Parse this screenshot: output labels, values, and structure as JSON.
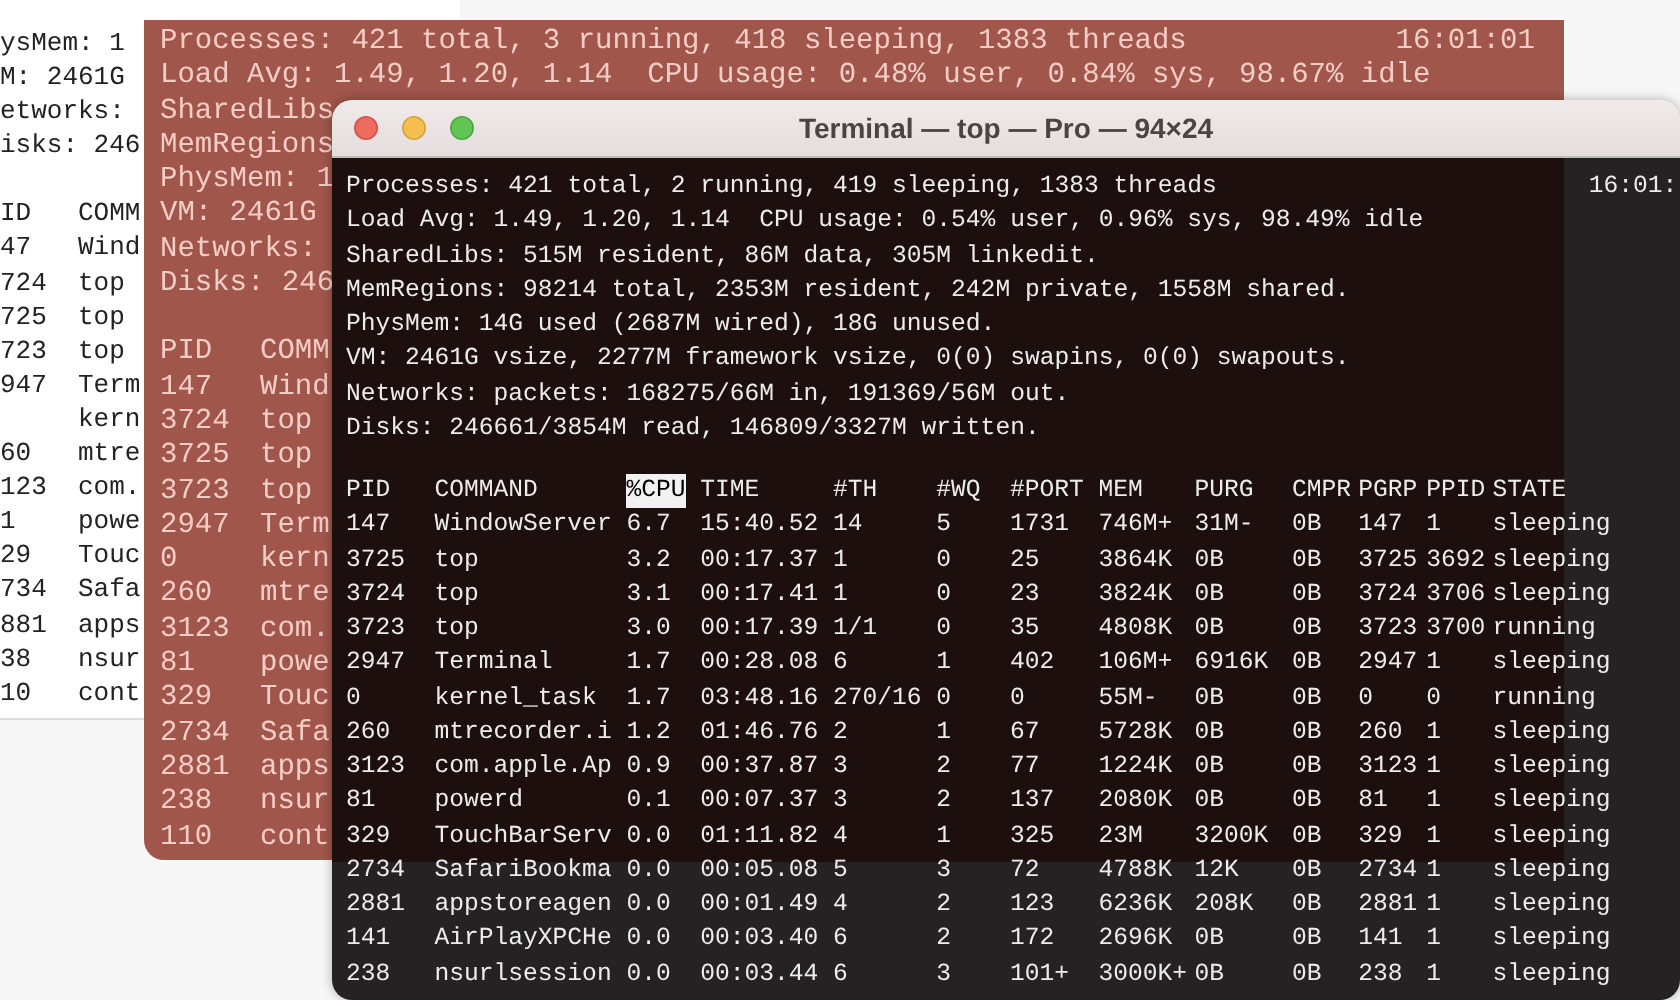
{
  "back_window": {
    "summary": [
      "ysMem: 1",
      "M: 2461G",
      "etworks:",
      "isks: 246"
    ],
    "rows": [
      {
        "pid": "ID",
        "command": "COMM"
      },
      {
        "pid": "47",
        "command": "Wind"
      },
      {
        "pid": "724",
        "command": "top"
      },
      {
        "pid": "725",
        "command": "top"
      },
      {
        "pid": "723",
        "command": "top"
      },
      {
        "pid": "947",
        "command": "Term"
      },
      {
        "command": "kern"
      },
      {
        "pid": "60",
        "command": "mtre"
      },
      {
        "pid": "123",
        "command": "com."
      },
      {
        "pid": "1",
        "command": "powe"
      },
      {
        "pid": "29",
        "command": "Touc"
      },
      {
        "pid": "734",
        "command": "Safa"
      },
      {
        "pid": "881",
        "command": "apps"
      },
      {
        "pid": "38",
        "command": "nsur"
      },
      {
        "pid": "10",
        "command": "cont"
      }
    ]
  },
  "middle_window": {
    "time": "16:01:01",
    "summary": [
      "Processes: 421 total, 3 running, 418 sleeping, 1383 threads",
      "Load Avg: 1.49, 1.20, 1.14  CPU usage: 0.48% user, 0.84% sys, 98.67% idle",
      "SharedLibs",
      "MemRegions",
      "PhysMem: 1",
      "VM: 2461G",
      "Networks:",
      "Disks: 246"
    ],
    "rows": [
      {
        "pid": "PID",
        "command": "COMM"
      },
      {
        "pid": "147",
        "command": "Wind"
      },
      {
        "pid": "3724",
        "command": "top"
      },
      {
        "pid": "3725",
        "command": "top"
      },
      {
        "pid": "3723",
        "command": "top"
      },
      {
        "pid": "2947",
        "command": "Term"
      },
      {
        "pid": "0",
        "command": "kern"
      },
      {
        "pid": "260",
        "command": "mtre"
      },
      {
        "pid": "3123",
        "command": "com."
      },
      {
        "pid": "81",
        "command": "powe"
      },
      {
        "pid": "329",
        "command": "Touc"
      },
      {
        "pid": "2734",
        "command": "Safa"
      },
      {
        "pid": "2881",
        "command": "apps"
      },
      {
        "pid": "238",
        "command": "nsur"
      },
      {
        "pid": "110",
        "command": "cont"
      }
    ]
  },
  "terminal": {
    "title": "Terminal — top — Pro — 94×24",
    "time": "16:01:",
    "summary": [
      "Processes: 421 total, 2 running, 419 sleeping, 1383 threads",
      "Load Avg: 1.49, 1.20, 1.14  CPU usage: 0.54% user, 0.96% sys, 98.49% idle",
      "SharedLibs: 515M resident, 86M data, 305M linkedit.",
      "MemRegions: 98214 total, 2353M resident, 242M private, 1558M shared.",
      "PhysMem: 14G used (2687M wired), 18G unused.",
      "VM: 2461G vsize, 2277M framework vsize, 0(0) swapins, 0(0) swapouts.",
      "Networks: packets: 168275/66M in, 191369/56M out.",
      "Disks: 246661/3854M read, 146809/3327M written."
    ],
    "columns": [
      {
        "label": "PID",
        "sorted": false
      },
      {
        "label": "COMMAND",
        "sorted": false
      },
      {
        "label": "%CPU",
        "sorted": true
      },
      {
        "label": "TIME",
        "sorted": false
      },
      {
        "label": "#TH",
        "sorted": false
      },
      {
        "label": "#WQ",
        "sorted": false
      },
      {
        "label": "#PORT",
        "sorted": false
      },
      {
        "label": "MEM",
        "sorted": false
      },
      {
        "label": "PURG",
        "sorted": false
      },
      {
        "label": "CMPR",
        "sorted": false
      },
      {
        "label": "PGRP",
        "sorted": false
      },
      {
        "label": "PPID",
        "sorted": false
      },
      {
        "label": "STATE",
        "sorted": false
      }
    ],
    "rows": [
      [
        "147",
        "WindowServer",
        "6.7",
        "15:40.52",
        "14",
        "5",
        "1731",
        "746M+",
        "31M-",
        "0B",
        "147",
        "1",
        "sleeping"
      ],
      [
        "3725",
        "top",
        "3.2",
        "00:17.37",
        "1",
        "0",
        "25",
        "3864K",
        "0B",
        "0B",
        "3725",
        "3692",
        "sleeping"
      ],
      [
        "3724",
        "top",
        "3.1",
        "00:17.41",
        "1",
        "0",
        "23",
        "3824K",
        "0B",
        "0B",
        "3724",
        "3706",
        "sleeping"
      ],
      [
        "3723",
        "top",
        "3.0",
        "00:17.39",
        "1/1",
        "0",
        "35",
        "4808K",
        "0B",
        "0B",
        "3723",
        "3700",
        "running"
      ],
      [
        "2947",
        "Terminal",
        "1.7",
        "00:28.08",
        "6",
        "1",
        "402",
        "106M+",
        "6916K",
        "0B",
        "2947",
        "1",
        "sleeping"
      ],
      [
        "0",
        "kernel_task",
        "1.7",
        "03:48.16",
        "270/16",
        "0",
        "0",
        "55M-",
        "0B",
        "0B",
        "0",
        "0",
        "running"
      ],
      [
        "260",
        "mtrecorder.i",
        "1.2",
        "01:46.76",
        "2",
        "1",
        "67",
        "5728K",
        "0B",
        "0B",
        "260",
        "1",
        "sleeping"
      ],
      [
        "3123",
        "com.apple.Ap",
        "0.9",
        "00:37.87",
        "3",
        "2",
        "77",
        "1224K",
        "0B",
        "0B",
        "3123",
        "1",
        "sleeping"
      ],
      [
        "81",
        "powerd",
        "0.1",
        "00:07.37",
        "3",
        "2",
        "137",
        "2080K",
        "0B",
        "0B",
        "81",
        "1",
        "sleeping"
      ],
      [
        "329",
        "TouchBarServ",
        "0.0",
        "01:11.82",
        "4",
        "1",
        "325",
        "23M",
        "3200K",
        "0B",
        "329",
        "1",
        "sleeping"
      ],
      [
        "2734",
        "SafariBookma",
        "0.0",
        "00:05.08",
        "5",
        "3",
        "72",
        "4788K",
        "12K",
        "0B",
        "2734",
        "1",
        "sleeping"
      ],
      [
        "2881",
        "appstoreagen",
        "0.0",
        "00:01.49",
        "4",
        "2",
        "123",
        "6236K",
        "208K",
        "0B",
        "2881",
        "1",
        "sleeping"
      ],
      [
        "141",
        "AirPlayXPCHe",
        "0.0",
        "00:03.40",
        "6",
        "2",
        "172",
        "2696K",
        "0B",
        "0B",
        "141",
        "1",
        "sleeping"
      ],
      [
        "238",
        "nsurlsession",
        "0.0",
        "00:03.44",
        "6",
        "3",
        "101+",
        "3000K+",
        "0B",
        "0B",
        "238",
        "1",
        "sleeping"
      ]
    ]
  }
}
